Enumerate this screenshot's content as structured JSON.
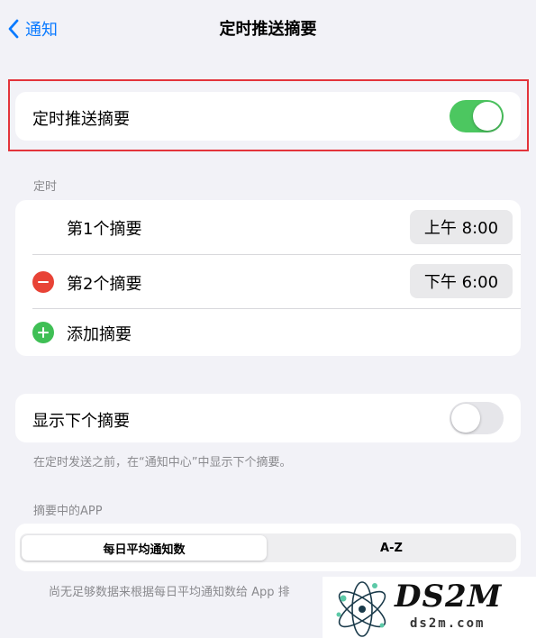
{
  "nav": {
    "back_label": "通知",
    "title": "定时推送摘要"
  },
  "scheduled_summary": {
    "label": "定时推送摘要",
    "enabled": true
  },
  "schedule": {
    "header": "定时",
    "items": [
      {
        "label": "第1个摘要",
        "time": "上午 8:00"
      },
      {
        "label": "第2个摘要",
        "time": "下午 6:00"
      }
    ],
    "add_label": "添加摘要"
  },
  "show_next": {
    "label": "显示下个摘要",
    "enabled": false,
    "footnote": "在定时发送之前，在“通知中心”中显示下个摘要。"
  },
  "apps": {
    "header": "摘要中的APP",
    "segments": [
      "每日平均通知数",
      "A-Z"
    ],
    "selected_segment": "每日平均通知数",
    "footnote": "尚无足够数据来根据每日平均通知数给 App 排"
  },
  "watermark": {
    "brand": "DS2M",
    "url": "ds2m.com"
  },
  "colors": {
    "accent": "#0a7aff",
    "toggle_on": "#4cc760",
    "remove": "#e84336",
    "add": "#3fbf55",
    "highlight": "#e3343b"
  }
}
